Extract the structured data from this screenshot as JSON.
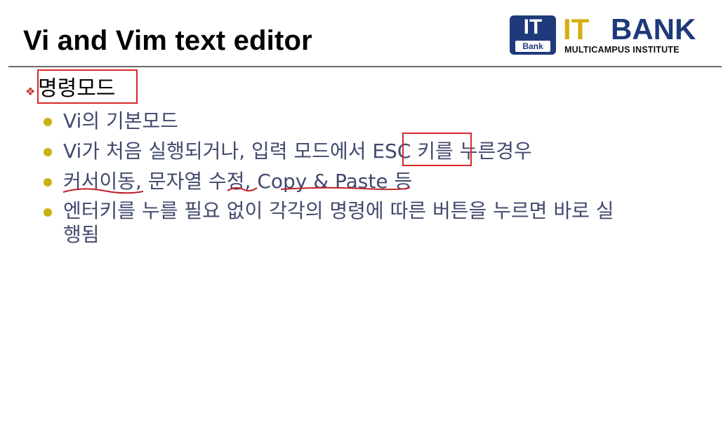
{
  "slide": {
    "title": "Vi and Vim text editor",
    "heading": "명령모드",
    "bullets": [
      "Vi의 기본모드",
      "Vi가 처음 실행되거나, 입력 모드에서 ESC 키를 누른경우",
      "커서이동, 문자열 수정, Copy & Paste 등",
      "엔터키를  누를 필요 없이 각각의 명령에 따른 버튼을 누르면 바로 실",
      "행됨"
    ]
  },
  "logo": {
    "box_top": "IT",
    "box_bottom": "Bank",
    "wordmark_left": "IT",
    "wordmark_right": "BANK",
    "subtitle": "MULTICAMPUS INSTITUTE"
  },
  "colors": {
    "highlight_box": "#d62a2a",
    "underline": "#c0202a",
    "bullet": "#c9b112",
    "body_text": "#414a6e",
    "logo_navy": "#1f3a7a",
    "logo_gold": "#d6ad11"
  }
}
